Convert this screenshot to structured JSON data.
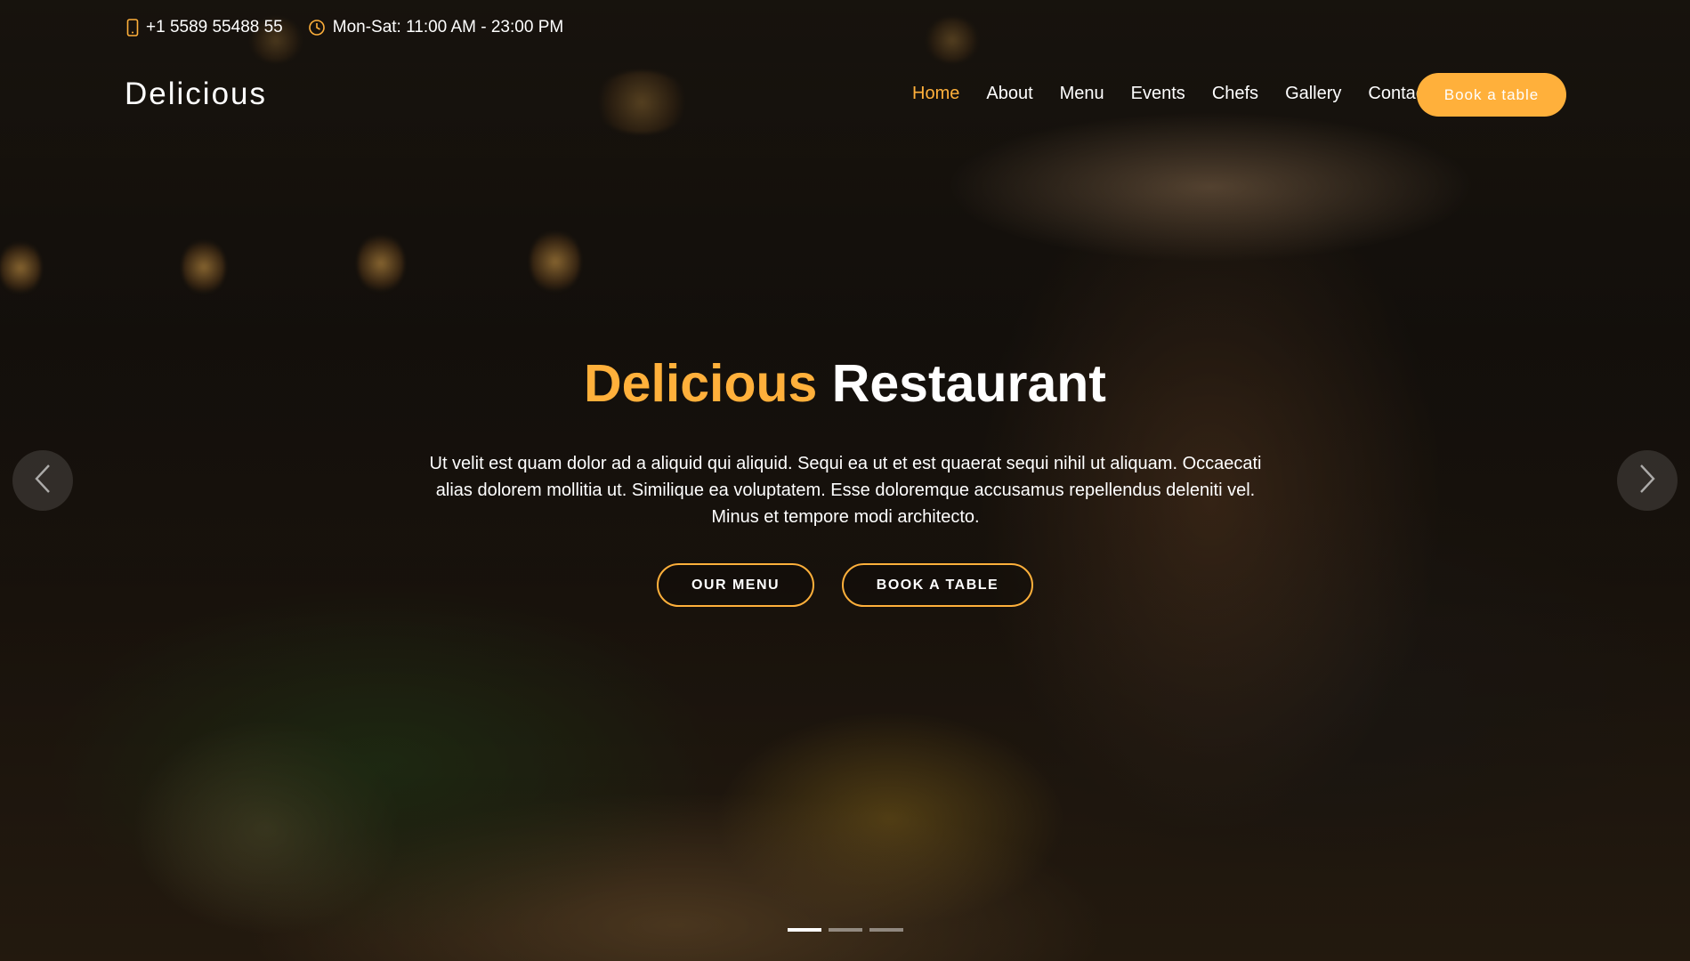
{
  "topbar": {
    "phone": "+1 5589 55488 55",
    "hours": "Mon-Sat: 11:00 AM - 23:00 PM",
    "phone_icon": "phone-icon",
    "clock_icon": "clock-icon"
  },
  "header": {
    "logo": "Delicious",
    "nav": [
      {
        "label": "Home",
        "active": true
      },
      {
        "label": "About"
      },
      {
        "label": "Menu"
      },
      {
        "label": "Events"
      },
      {
        "label": "Chefs"
      },
      {
        "label": "Gallery"
      },
      {
        "label": "Contact"
      }
    ],
    "book_button": "Book a table"
  },
  "hero": {
    "title_accent": "Delicious",
    "title_rest": "Restaurant",
    "text": "Ut velit est quam dolor ad a aliquid qui aliquid. Sequi ea ut et est quaerat sequi nihil ut aliquam. Occaecati alias dolorem mollitia ut. Similique ea voluptatem. Esse doloremque accusamus repellendus deleniti vel. Minus et tempore modi architecto.",
    "cta_menu": "OUR MENU",
    "cta_table": "BOOK A TABLE"
  },
  "carousel": {
    "prev_icon": "chevron-left-icon",
    "next_icon": "chevron-right-icon",
    "slide_count": 3,
    "active_slide": 1
  },
  "colors": {
    "accent": "#ffb03b",
    "text": "#ffffff"
  }
}
